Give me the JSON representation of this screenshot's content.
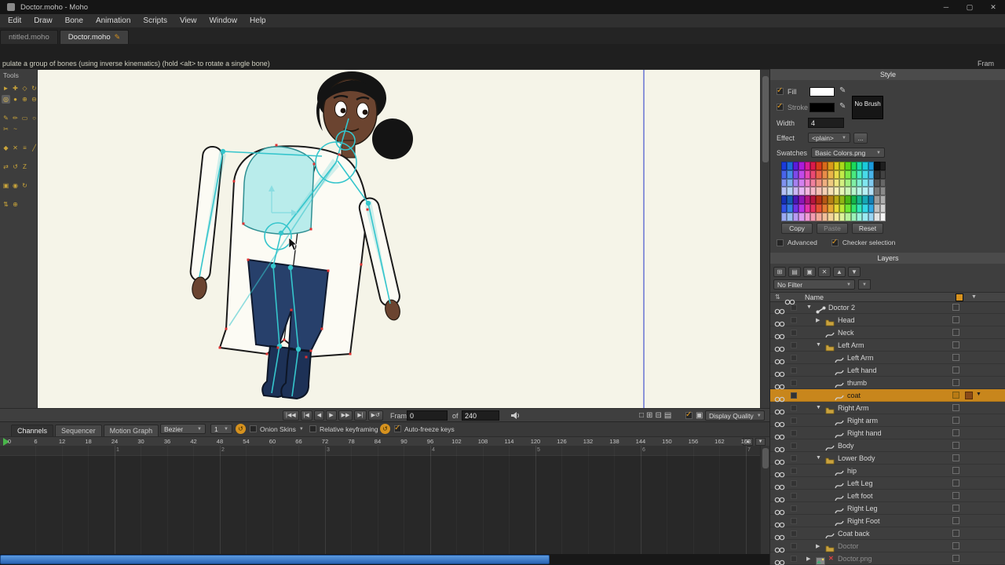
{
  "window": {
    "title": "Doctor.moho - Moho",
    "minimize_glyph": "─",
    "maximize_glyph": "▢",
    "close_glyph": "✕"
  },
  "icons": {
    "pencil": "✎",
    "dropdown": "▼",
    "swap": "⇅",
    "zoom_in": "▲",
    "zoom_out": "▼",
    "film": "▣"
  },
  "menubar": {
    "items": [
      "Edit",
      "Draw",
      "Bone",
      "Animation",
      "Scripts",
      "View",
      "Window",
      "Help"
    ]
  },
  "tabbar": {
    "tabs": [
      {
        "label": "ntitled.moho",
        "active": false,
        "modified": false
      },
      {
        "label": "Doctor.moho",
        "active": true,
        "modified": true
      }
    ]
  },
  "statusbar": {
    "hint": "pulate a group of bones (using inverse kinematics) (hold <alt> to rotate a single bone)",
    "right_text": "Fram"
  },
  "tools_panel": {
    "title": "Tools",
    "groups": [
      [
        {
          "name": "select-bone",
          "glyph": "►"
        },
        {
          "name": "translate-bone",
          "glyph": "✚"
        },
        {
          "name": "scale-bone",
          "glyph": "◇"
        },
        {
          "name": "rotate-bone",
          "glyph": "↻"
        },
        {
          "name": "manipulate-bones",
          "glyph": "◎",
          "selected": true
        },
        {
          "name": "bone-strength",
          "glyph": "●"
        },
        {
          "name": "add-bone",
          "glyph": "⊕"
        },
        {
          "name": "delete-bone",
          "glyph": "⊖"
        }
      ],
      [
        {
          "name": "draw-freehand",
          "glyph": "✎"
        },
        {
          "name": "draw-blob",
          "glyph": "✏"
        },
        {
          "name": "draw-rectangle",
          "glyph": "▭"
        },
        {
          "name": "draw-ellipse",
          "glyph": "○"
        },
        {
          "name": "delete-edge",
          "glyph": "✂"
        },
        {
          "name": "curvature",
          "glyph": "~"
        }
      ],
      [
        {
          "name": "paint-bucket",
          "glyph": "◆"
        },
        {
          "name": "delete-shape",
          "glyph": "✕"
        },
        {
          "name": "line-width",
          "glyph": "≡"
        },
        {
          "name": "hide-edge",
          "glyph": "╱"
        }
      ],
      [
        {
          "name": "transform-layer",
          "glyph": "⇄"
        },
        {
          "name": "rotate-layer",
          "glyph": "↺"
        },
        {
          "name": "shear-layer",
          "glyph": "Z"
        }
      ],
      [
        {
          "name": "track-camera",
          "glyph": "▣"
        },
        {
          "name": "orbit-camera",
          "glyph": "◉"
        },
        {
          "name": "roll-camera",
          "glyph": "↻"
        }
      ],
      [
        {
          "name": "pan-workspace",
          "glyph": "⇅"
        },
        {
          "name": "zoom-workspace",
          "glyph": "⊕"
        }
      ]
    ]
  },
  "canvas": {
    "colors": {
      "background": "#f5f4e8",
      "boundary": "#8a93d8",
      "skin": "#6b4430",
      "hair": "#141414",
      "coat": "#fcfbf4",
      "shirt": "#b9eceb",
      "shirt_outline": "#2e8f92",
      "pants": "#27406b",
      "boots": "#1d3156",
      "outline": "#1b1b1b",
      "bone": "#35c5cc",
      "bone_soft": "#8adde2",
      "vertex": "#e03030",
      "selection": "#c8861c"
    }
  },
  "playback": {
    "transport": [
      {
        "name": "jump-start-button",
        "glyph": "|◀◀"
      },
      {
        "name": "step-back-button",
        "glyph": "|◀"
      },
      {
        "name": "play-reverse-button",
        "glyph": "◀"
      },
      {
        "name": "play-button",
        "glyph": "▶"
      },
      {
        "name": "fast-forward-button",
        "glyph": "▶▶"
      },
      {
        "name": "step-forward-button",
        "glyph": "▶|"
      },
      {
        "name": "loop-button",
        "glyph": "▶↺"
      }
    ],
    "frame_label": "Frame",
    "frame_value": "0",
    "of_label": "of",
    "end_frame": "240",
    "view_icons": [
      "□",
      "⊞",
      "⊟",
      "▤"
    ],
    "display_quality_label": "Display Quality"
  },
  "timeline": {
    "tabs": [
      {
        "label": "Channels",
        "active": true
      },
      {
        "label": "Sequencer",
        "active": false
      },
      {
        "label": "Motion Graph",
        "active": false
      }
    ],
    "interpolation_value": "Bezier",
    "depth_value": "1",
    "onion_label": "Onion Skins",
    "relative_label": "Relative keyframing",
    "autofreeze_label": "Auto-freeze keys",
    "badge_glyph": "↺",
    "ruler": {
      "start": 0,
      "end": 168,
      "step": 6
    },
    "second_markers": [
      "1",
      "2",
      "3",
      "4",
      "5",
      "6",
      "7"
    ]
  },
  "style_panel": {
    "title": "Style",
    "fill_label": "Fill",
    "stroke_label": "Stroke",
    "fill_color": "#ffffff",
    "stroke_color": "#000000",
    "no_brush_label": "No Brush",
    "width_label": "Width",
    "width_value": "4",
    "effect_label": "Effect",
    "effect_value": "<plain>",
    "effect_more": "...",
    "swatches_label": "Swatches",
    "swatches_value": "Basic Colors.png",
    "copy_label": "Copy",
    "paste_label": "Paste",
    "reset_label": "Reset",
    "advanced_label": "Advanced",
    "checker_label": "Checker selection",
    "palette": {
      "rows": 7,
      "cols": 18
    }
  },
  "layers_panel": {
    "title": "Layers",
    "filter_value": "No Filter",
    "name_header": "Name",
    "toolbar": [
      {
        "name": "new-layer-button",
        "glyph": "⊞"
      },
      {
        "name": "new-group-button",
        "glyph": "▤"
      },
      {
        "name": "duplicate-layer-button",
        "glyph": "▣"
      },
      {
        "name": "delete-layer-button",
        "glyph": "✕"
      },
      {
        "name": "move-layer-up-button",
        "glyph": "▲"
      },
      {
        "name": "move-layer-down-button",
        "glyph": "▼"
      }
    ],
    "layers": [
      {
        "name": "Doctor 2",
        "type": "bone",
        "indent": 0,
        "expander": "down"
      },
      {
        "name": "Head",
        "type": "folder",
        "indent": 1,
        "expander": "right"
      },
      {
        "name": "Neck",
        "type": "vector",
        "indent": 1,
        "expander": "none"
      },
      {
        "name": "Left Arm",
        "type": "folder",
        "indent": 1,
        "expander": "down"
      },
      {
        "name": "Left Arm",
        "type": "vector",
        "indent": 2,
        "expander": "none"
      },
      {
        "name": "Left hand",
        "type": "vector",
        "indent": 2,
        "expander": "none"
      },
      {
        "name": "thumb",
        "type": "vector",
        "indent": 2,
        "expander": "none"
      },
      {
        "name": "coat",
        "type": "vector",
        "indent": 2,
        "expander": "none",
        "selected": true
      },
      {
        "name": "Right Arm",
        "type": "folder",
        "indent": 1,
        "expander": "down"
      },
      {
        "name": "Right arm",
        "type": "vector",
        "indent": 2,
        "expander": "none"
      },
      {
        "name": "Right hand",
        "type": "vector",
        "indent": 2,
        "expander": "none"
      },
      {
        "name": "Body",
        "type": "vector",
        "indent": 1,
        "expander": "none"
      },
      {
        "name": "Lower Body",
        "type": "folder",
        "indent": 1,
        "expander": "down"
      },
      {
        "name": "hip",
        "type": "vector",
        "indent": 2,
        "expander": "none"
      },
      {
        "name": "Left Leg",
        "type": "vector",
        "indent": 2,
        "expander": "none"
      },
      {
        "name": "Left foot",
        "type": "vector",
        "indent": 2,
        "expander": "none"
      },
      {
        "name": "Right Leg",
        "type": "vector",
        "indent": 2,
        "expander": "none"
      },
      {
        "name": "Right Foot",
        "type": "vector",
        "indent": 2,
        "expander": "none"
      },
      {
        "name": "Coat back",
        "type": "vector",
        "indent": 1,
        "expander": "none"
      },
      {
        "name": "Doctor",
        "type": "folder",
        "indent": 1,
        "expander": "right",
        "dim": true
      },
      {
        "name": "Doctor.png",
        "type": "image",
        "indent": 0,
        "expander": "right",
        "dim": true,
        "error": true
      }
    ]
  },
  "colors": {
    "accent_orange": "#d6921f",
    "selection_orange": "#c8861c",
    "playhead_green": "#49b64a",
    "scrollbar_blue": "#2f74c8"
  }
}
